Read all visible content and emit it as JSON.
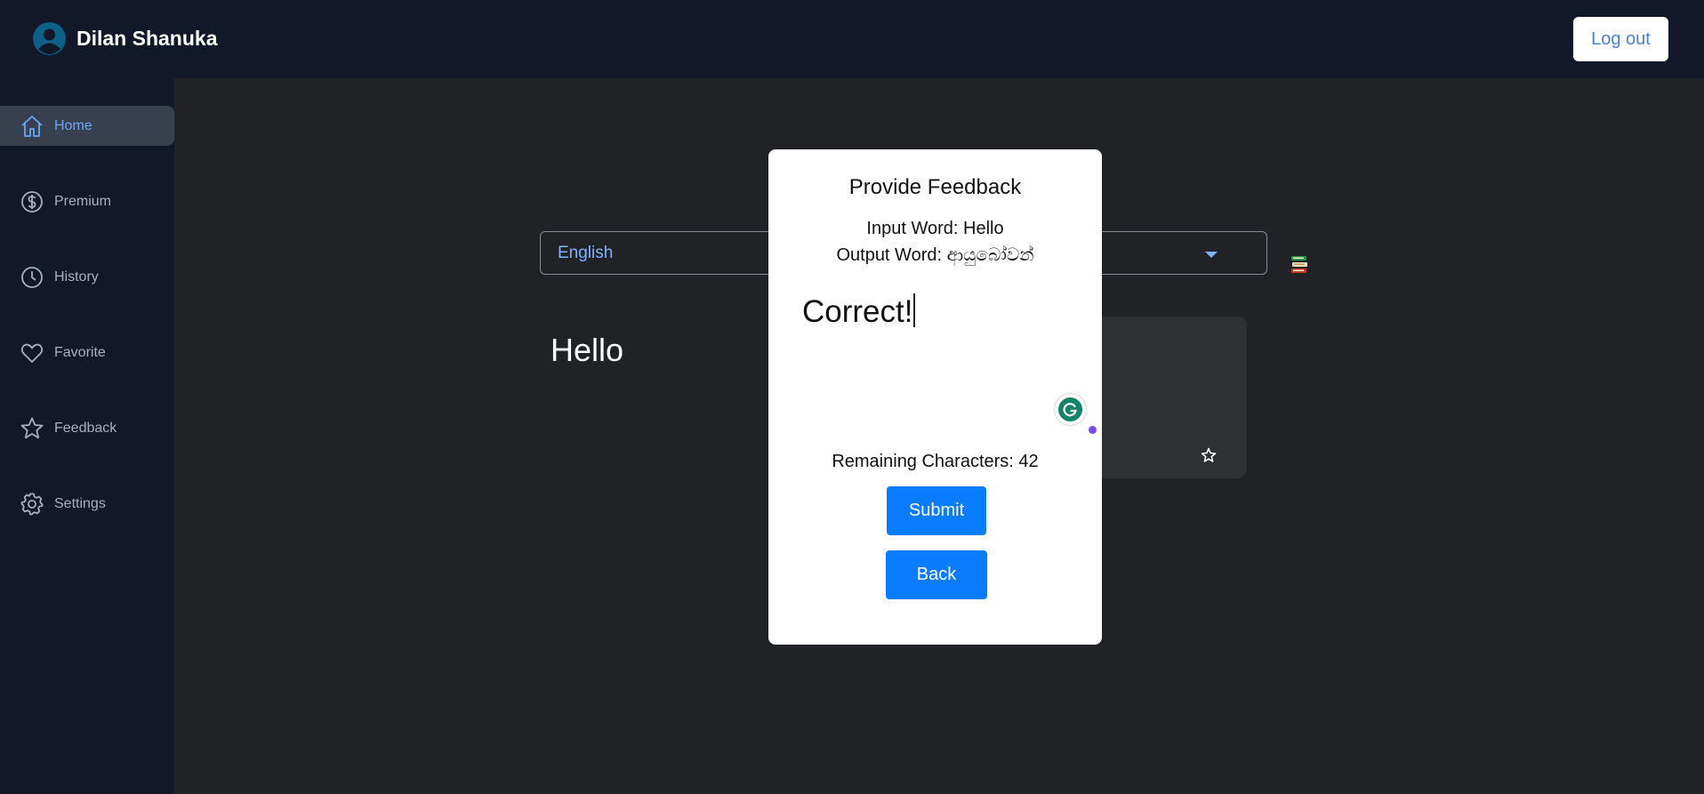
{
  "header": {
    "user_name": "Dilan Shanuka",
    "avatar_icon": "user-avatar-icon",
    "logout_label": "Log out"
  },
  "sidebar": {
    "items": [
      {
        "label": "Home",
        "icon": "home-icon",
        "active": true
      },
      {
        "label": "Premium",
        "icon": "dollar-icon",
        "active": false
      },
      {
        "label": "History",
        "icon": "clock-icon",
        "active": false
      },
      {
        "label": "Favorite",
        "icon": "heart-icon",
        "active": false
      },
      {
        "label": "Feedback",
        "icon": "star-icon",
        "active": false
      },
      {
        "label": "Settings",
        "icon": "gear-icon",
        "active": false
      }
    ]
  },
  "translator": {
    "source_language": "English",
    "input_text": "Hello"
  },
  "modal": {
    "title": "Provide Feedback",
    "input_word_line": "Input Word: Hello",
    "output_word_line": "Output Word: ආයුබෝවන්",
    "feedback_value": "Correct!",
    "remaining_line": "Remaining Characters: 42",
    "submit_label": "Submit",
    "back_label": "Back"
  },
  "colors": {
    "topbar": "#121829",
    "sidebar": "#121829",
    "main_bg": "#212226",
    "accent_blue": "#0a7cff",
    "active_nav_text": "#6ea6f5"
  }
}
